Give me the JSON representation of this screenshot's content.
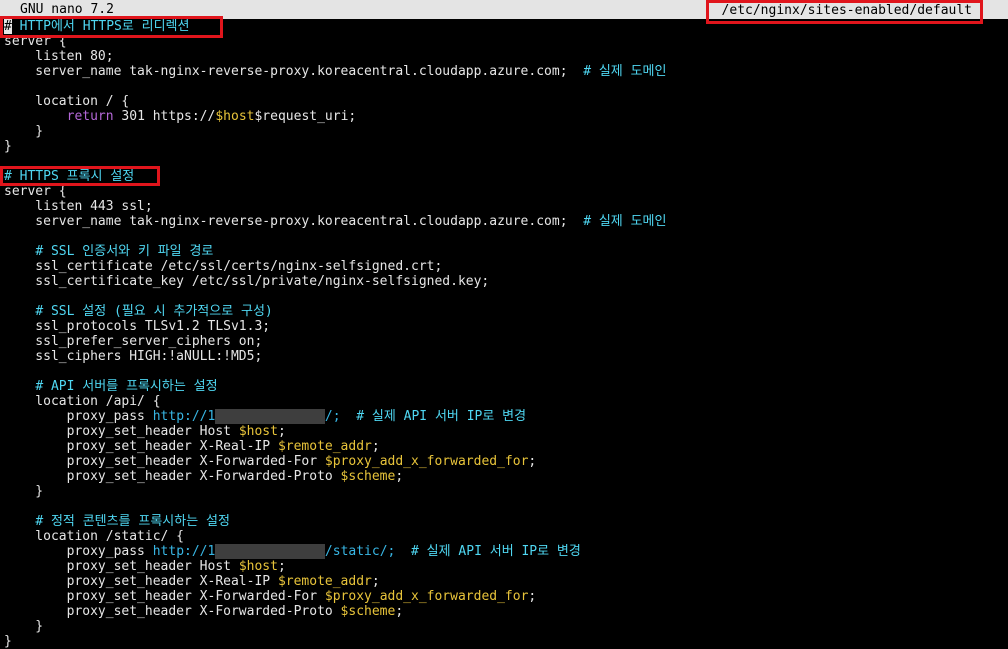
{
  "titlebar": {
    "app_name": "GNU nano 7.2",
    "file_path": "/etc/nginx/sites-enabled/default"
  },
  "colors": {
    "comment": "#4fd7f2",
    "keyword": "#b468d8",
    "variable": "#e8c43a",
    "url": "#38b6e4",
    "highlight_box": "#e0151c"
  },
  "editor": {
    "lines": [
      [
        {
          "t": "#",
          "c": "cursor"
        },
        {
          "t": " HTTP에서 HTTPS로 리디렉션",
          "c": "comment"
        }
      ],
      [
        {
          "t": "server {"
        }
      ],
      [
        {
          "t": "    listen 80;"
        }
      ],
      [
        {
          "t": "    server_name tak-nginx-reverse-proxy.koreacentral.cloudapp.azure.com;  "
        },
        {
          "t": "# 실제 도메인",
          "c": "comment"
        }
      ],
      [
        {
          "t": ""
        }
      ],
      [
        {
          "t": "    location / {"
        }
      ],
      [
        {
          "t": "        "
        },
        {
          "t": "return",
          "c": "kw"
        },
        {
          "t": " 301 https://"
        },
        {
          "t": "$host",
          "c": "var"
        },
        {
          "t": "$request_uri;"
        }
      ],
      [
        {
          "t": "    }"
        }
      ],
      [
        {
          "t": "}"
        }
      ],
      [
        {
          "t": ""
        }
      ],
      [
        {
          "t": "# HTTPS 프록시 설정",
          "c": "comment"
        }
      ],
      [
        {
          "t": "server {"
        }
      ],
      [
        {
          "t": "    listen 443 ssl;"
        }
      ],
      [
        {
          "t": "    server_name tak-nginx-reverse-proxy.koreacentral.cloudapp.azure.com;  "
        },
        {
          "t": "# 실제 도메인",
          "c": "comment"
        }
      ],
      [
        {
          "t": ""
        }
      ],
      [
        {
          "t": "    "
        },
        {
          "t": "# SSL 인증서와 키 파일 경로",
          "c": "comment"
        }
      ],
      [
        {
          "t": "    ssl_certificate /etc/ssl/certs/nginx-selfsigned.crt;"
        }
      ],
      [
        {
          "t": "    ssl_certificate_key /etc/ssl/private/nginx-selfsigned.key;"
        }
      ],
      [
        {
          "t": ""
        }
      ],
      [
        {
          "t": "    "
        },
        {
          "t": "# SSL 설정 (필요 시 추가적으로 구성)",
          "c": "comment"
        }
      ],
      [
        {
          "t": "    ssl_protocols TLSv1.2 TLSv1.3;"
        }
      ],
      [
        {
          "t": "    ssl_prefer_server_ciphers on;"
        }
      ],
      [
        {
          "t": "    ssl_ciphers HIGH:!aNULL:!MD5;"
        }
      ],
      [
        {
          "t": ""
        }
      ],
      [
        {
          "t": "    "
        },
        {
          "t": "# API 서버를 프록시하는 설정",
          "c": "comment"
        }
      ],
      [
        {
          "t": "    location /api/ {"
        }
      ],
      [
        {
          "t": "        proxy_pass "
        },
        {
          "t": "http://1",
          "c": "url"
        },
        {
          "t": "██████████████",
          "c": "redact"
        },
        {
          "t": "/;",
          "c": "url"
        },
        {
          "t": "  "
        },
        {
          "t": "# 실제 API 서버 IP로 변경",
          "c": "comment"
        }
      ],
      [
        {
          "t": "        proxy_set_header Host "
        },
        {
          "t": "$host",
          "c": "var"
        },
        {
          "t": ";"
        }
      ],
      [
        {
          "t": "        proxy_set_header X-Real-IP "
        },
        {
          "t": "$remote_addr",
          "c": "var"
        },
        {
          "t": ";"
        }
      ],
      [
        {
          "t": "        proxy_set_header X-Forwarded-For "
        },
        {
          "t": "$proxy_add_x_forwarded_for",
          "c": "var"
        },
        {
          "t": ";"
        }
      ],
      [
        {
          "t": "        proxy_set_header X-Forwarded-Proto "
        },
        {
          "t": "$scheme",
          "c": "var"
        },
        {
          "t": ";"
        }
      ],
      [
        {
          "t": "    }"
        }
      ],
      [
        {
          "t": ""
        }
      ],
      [
        {
          "t": "    "
        },
        {
          "t": "# 정적 콘텐츠를 프록시하는 설정",
          "c": "comment"
        }
      ],
      [
        {
          "t": "    location /static/ {"
        }
      ],
      [
        {
          "t": "        proxy_pass "
        },
        {
          "t": "http://1",
          "c": "url"
        },
        {
          "t": "██████████████",
          "c": "redact"
        },
        {
          "t": "/static/;",
          "c": "url"
        },
        {
          "t": "  "
        },
        {
          "t": "# 실제 API 서버 IP로 변경",
          "c": "comment"
        }
      ],
      [
        {
          "t": "        proxy_set_header Host "
        },
        {
          "t": "$host",
          "c": "var"
        },
        {
          "t": ";"
        }
      ],
      [
        {
          "t": "        proxy_set_header X-Real-IP "
        },
        {
          "t": "$remote_addr",
          "c": "var"
        },
        {
          "t": ";"
        }
      ],
      [
        {
          "t": "        proxy_set_header X-Forwarded-For "
        },
        {
          "t": "$proxy_add_x_forwarded_for",
          "c": "var"
        },
        {
          "t": ";"
        }
      ],
      [
        {
          "t": "        proxy_set_header X-Forwarded-Proto "
        },
        {
          "t": "$scheme",
          "c": "var"
        },
        {
          "t": ";"
        }
      ],
      [
        {
          "t": "    }"
        }
      ],
      [
        {
          "t": "}"
        }
      ]
    ]
  }
}
